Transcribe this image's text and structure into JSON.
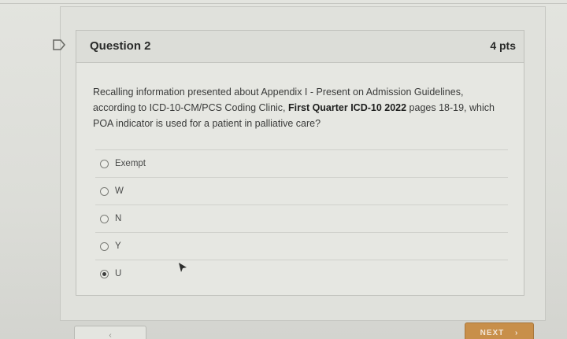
{
  "question": {
    "title": "Question 2",
    "points": "4 pts",
    "text_part1": "Recalling information presented about Appendix I - Present on Admission Guidelines, according to ICD-10-CM/PCS Coding Clinic, ",
    "text_bold": "First Quarter ICD-10 2022",
    "text_part2": " pages 18-19, which POA indicator is used for a patient in palliative care?"
  },
  "answers": [
    {
      "label": "Exempt",
      "selected": false
    },
    {
      "label": "W",
      "selected": false
    },
    {
      "label": "N",
      "selected": false
    },
    {
      "label": "Y",
      "selected": false
    },
    {
      "label": "U",
      "selected": true
    }
  ],
  "nav": {
    "next_label": "NEXT",
    "next_icon": "chevron-right-icon",
    "prev_icon": "chevron-left-icon"
  },
  "colors": {
    "next_button": "#c88f4a",
    "card_background": "#e6e7e2"
  }
}
